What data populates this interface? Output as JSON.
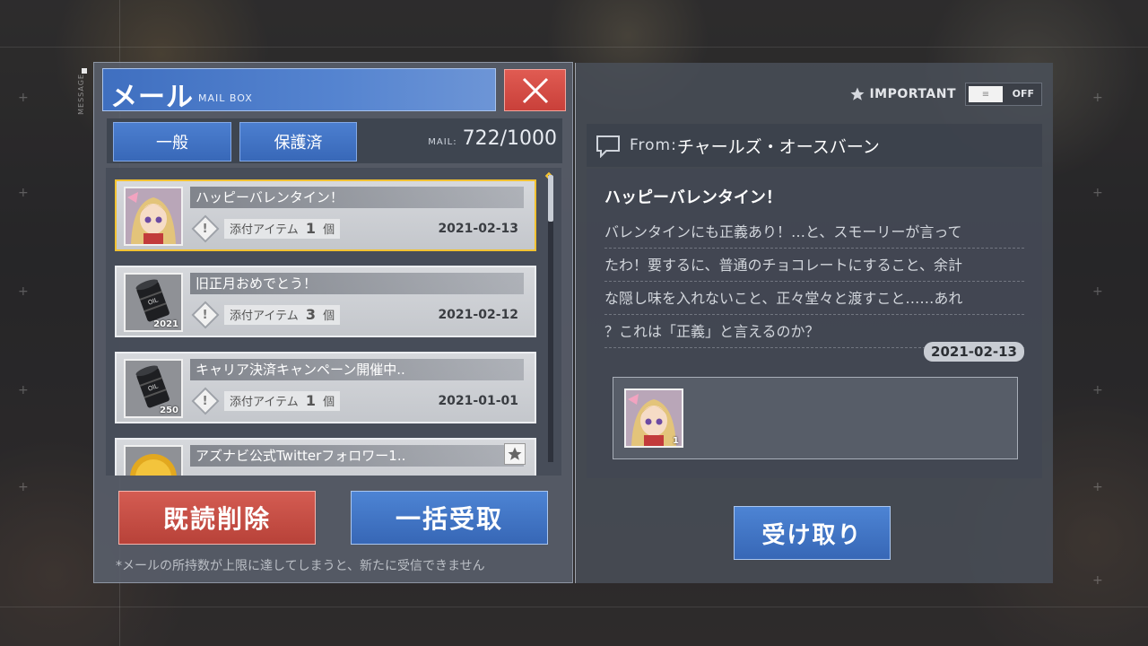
{
  "side_label": "MESSAGE",
  "mailbox": {
    "title": "メール",
    "subtitle": "MAIL BOX",
    "tabs": [
      {
        "label": "一般"
      },
      {
        "label": "保護済"
      }
    ],
    "mail_label": "MAIL:",
    "mail_count": "722/1000",
    "items": [
      {
        "title": "ハッピーバレンタイン！",
        "attach_label": "添付アイテム",
        "attach_count": "1",
        "attach_unit": "個",
        "date": "2021-02-13",
        "thumb": "character-avatar",
        "selected": true
      },
      {
        "title": "旧正月おめでとう！",
        "attach_label": "添付アイテム",
        "attach_count": "3",
        "attach_unit": "個",
        "date": "2021-02-12",
        "thumb": "oil-barrel",
        "thumb_qty": "2021"
      },
      {
        "title": "キャリア決済キャンペーン開催中..",
        "attach_label": "添付アイテム",
        "attach_count": "1",
        "attach_unit": "個",
        "date": "2021-01-01",
        "thumb": "oil-barrel",
        "thumb_qty": "250"
      },
      {
        "title": "アズナビ公式Twitterフォロワー1..",
        "thumb": "gold-coin",
        "important": true
      }
    ],
    "delete_read_label": "既読削除",
    "claim_all_label": "一括受取",
    "footnote": "*メールの所持数が上限に達してしまうと、新たに受信できません"
  },
  "detail": {
    "important_label": "IMPORTANT",
    "toggle_state": "OFF",
    "from_label": "From:",
    "from_name": "チャールズ・オースバーン",
    "title": "ハッピーバレンタイン！",
    "body_lines": [
      "バレンタインにも正義あり！…と、スモーリーが言って",
      "たわ！要するに、普通のチョコレートにすること、余計",
      "な隠し味を入れないこと、正々堂々と渡すこと……あれ",
      "？これは「正義」と言えるのか？"
    ],
    "date": "2021-02-13",
    "attachment_qty": "1",
    "receive_label": "受け取り"
  },
  "colors": {
    "accent_blue": "#3f6fc0",
    "delete_red": "#c9403a",
    "selected_gold": "#f2c232"
  }
}
